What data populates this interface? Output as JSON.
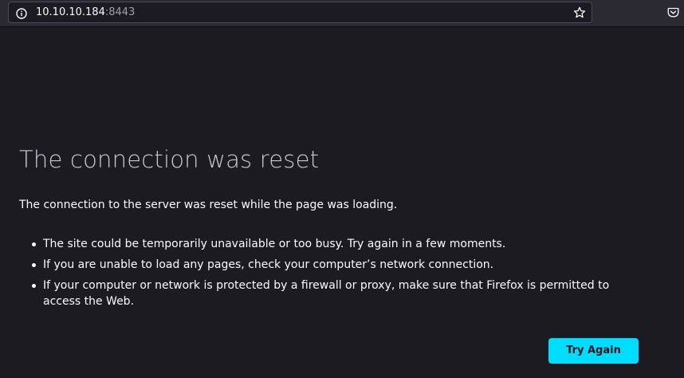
{
  "browser": {
    "url_host": "10.10.10.184",
    "url_port": ":8443",
    "icons": {
      "site_info": "info-icon",
      "bookmark": "star-icon",
      "pocket": "pocket-icon"
    }
  },
  "error_page": {
    "title": "The connection was reset",
    "description": "The connection to the server was reset while the page was loading.",
    "tips": [
      "The site could be temporarily unavailable or too busy. Try again in a few moments.",
      "If you are unable to load any pages, check your computer’s network connection.",
      "If your computer or network is protected by a firewall or proxy, make sure that Firefox is permitted to access the Web."
    ],
    "try_again_label": "Try Again"
  },
  "colors": {
    "background": "#1c1b22",
    "toolbar": "#2b2a33",
    "accent": "#00ddff",
    "text": "#fbfbfe",
    "muted": "#9f9ea6"
  }
}
